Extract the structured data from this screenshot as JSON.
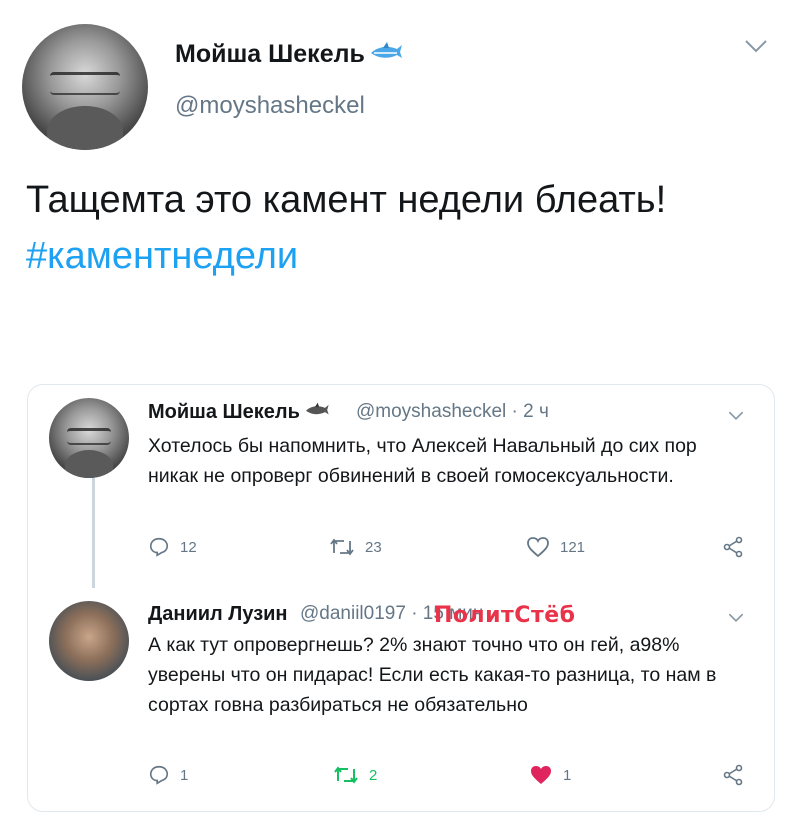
{
  "main_tweet": {
    "author_name": "Мойша Шекель",
    "author_handle": "@moyshasheckel",
    "text": "Тащемта это камент недели блеать!",
    "hashtag": "#каментнедели"
  },
  "quoted": {
    "tweet1": {
      "author_name": "Мойша Шекель",
      "handle_time": "@moyshasheckel · 2 ч",
      "text": "Хотелось бы напомнить, что Алексей Навальный до сих пор никак не опроверг обвинений в своей гомосексуальности.",
      "replies": "12",
      "retweets": "23",
      "likes": "121"
    },
    "tweet2": {
      "author_name": "Даниил Лузин",
      "handle_time": "@daniil0197 · 15 мин",
      "text": "А как тут опровергнешь? 2% знают точно что он гей, а98% уверены что он пидарас! Если есть какая-то разница, то нам в сортах говна разбираться не обязательно",
      "replies": "1",
      "retweets": "2",
      "likes": "1"
    }
  },
  "watermark": "ПолитСтёб",
  "colors": {
    "accent": "#1da1f2",
    "retweet_active": "#17bf63",
    "like_active": "#e0245e",
    "muted": "#657786"
  },
  "icons": [
    "chevron-down-icon",
    "shark-icon",
    "reply-icon",
    "retweet-icon",
    "like-icon",
    "share-icon"
  ]
}
